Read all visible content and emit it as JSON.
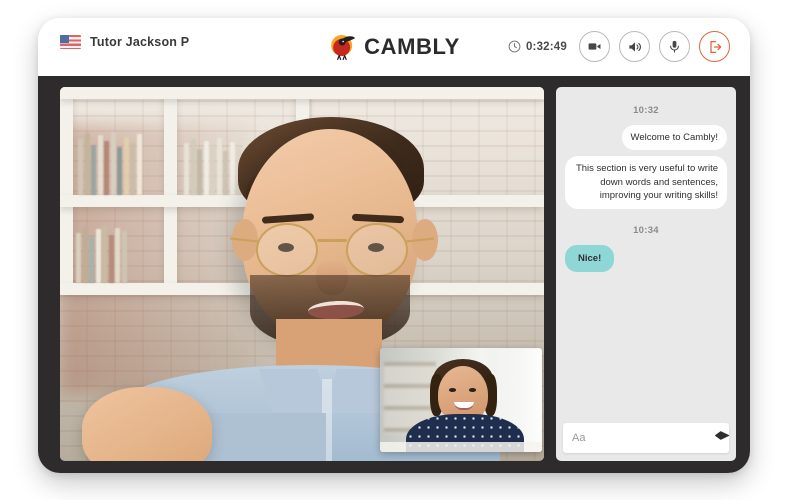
{
  "header": {
    "tutor_label": "Tutor Jackson P",
    "flag_icon": "us-flag-icon",
    "logo_text": "CAMBLY",
    "logo_mark": "cambly-bird-logo",
    "timer": {
      "icon": "clock-icon",
      "value": "0:32:49"
    },
    "controls": [
      {
        "name": "video-toggle-button",
        "icon": "video-camera-icon"
      },
      {
        "name": "speaker-toggle-button",
        "icon": "speaker-icon"
      },
      {
        "name": "microphone-toggle-button",
        "icon": "microphone-icon"
      },
      {
        "name": "leave-session-button",
        "icon": "exit-arrow-icon"
      }
    ],
    "accent_color": "#e0643c"
  },
  "video": {
    "main_stream_name": "tutor-video-stream",
    "self_stream_name": "self-video-stream"
  },
  "chat": {
    "groups": [
      {
        "time": "10:32",
        "messages": [
          {
            "side": "out",
            "text": "Welcome to Cambly!"
          },
          {
            "side": "out",
            "text": "This section is very useful to write down words and sentences, improving your writing skills!"
          }
        ]
      },
      {
        "time": "10:34",
        "messages": [
          {
            "side": "in",
            "text": "Nice!"
          }
        ]
      }
    ],
    "input": {
      "value": "",
      "placeholder": "Aa"
    },
    "send_icon": "send-icon",
    "bubble_in_color": "#8fd6d6",
    "bubble_out_color": "#ffffff",
    "panel_color": "#e9e9e9"
  }
}
